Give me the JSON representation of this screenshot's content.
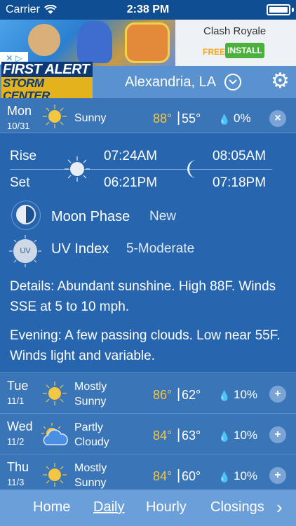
{
  "status_bar": {
    "carrier": "Carrier",
    "time": "2:38 PM",
    "battery_level": 1.0
  },
  "ad": {
    "title": "Clash Royale",
    "free_label": "FREE",
    "install_label": "INSTALL"
  },
  "header": {
    "logo_line1": "FIRST ALERT",
    "logo_line2": "STORM CENTER",
    "city": "Alexandria, LA"
  },
  "today": {
    "day": "Mon",
    "date": "10/31",
    "condition": "Sunny",
    "high": "88°",
    "separator": "|",
    "low": "55°",
    "precip": "0%",
    "button": "×"
  },
  "details": {
    "rise_label": "Rise",
    "set_label": "Set",
    "sunrise": "07:24AM",
    "sunset": "06:21PM",
    "moonrise": "08:05AM",
    "moonset": "07:18PM",
    "moon_phase_label": "Moon Phase",
    "moon_phase_value": "New",
    "uv_label": "UV Index",
    "uv_value": "5-Moderate",
    "uv_icon_text": "UV",
    "details_text": "Details: Abundant sunshine. High 88F. Winds SSE at 5 to 10 mph.",
    "evening_text": "Evening: A few passing clouds. Low near 55F. Winds light and variable."
  },
  "forecast": [
    {
      "day": "Tue",
      "date": "11/1",
      "cond1": "Mostly",
      "cond2": "Sunny",
      "icon": "sun-icon",
      "high": "86°",
      "sep": "|",
      "low": "62°",
      "precip": "10%",
      "button": "+"
    },
    {
      "day": "Wed",
      "date": "11/2",
      "cond1": "Partly",
      "cond2": "Cloudy",
      "icon": "partly-cloudy-icon",
      "high": "84°",
      "sep": "|",
      "low": "63°",
      "precip": "10%",
      "button": "+"
    },
    {
      "day": "Thu",
      "date": "11/3",
      "cond1": "Mostly",
      "cond2": "Sunny",
      "icon": "sun-icon",
      "high": "84°",
      "sep": "|",
      "low": "60°",
      "precip": "10%",
      "button": "+"
    }
  ],
  "tabs": {
    "home": "Home",
    "daily": "Daily",
    "hourly": "Hourly",
    "closings": "Closings",
    "next": "›"
  },
  "colors": {
    "background": "#1f63ad",
    "row": "#3a75b8",
    "high_temp": "#f5c642",
    "tabbar": "#6b9fd9",
    "install": "#4bb03d"
  }
}
